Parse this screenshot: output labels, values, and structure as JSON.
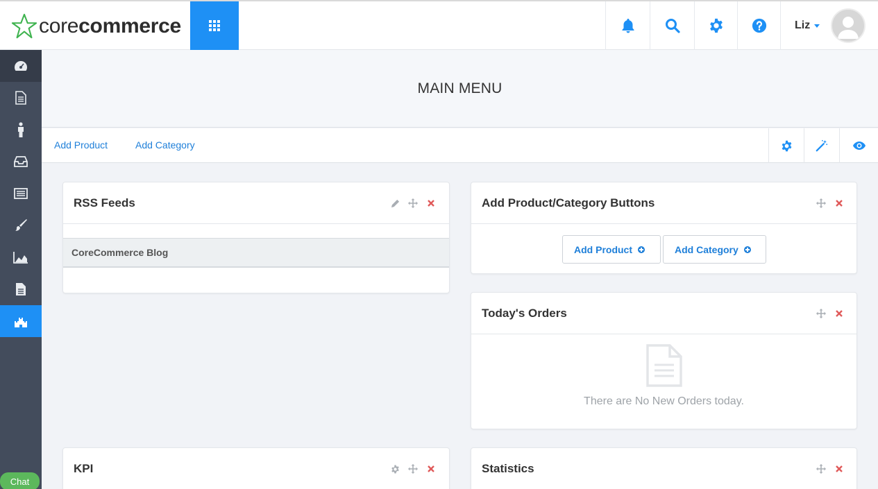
{
  "brand": {
    "name_part1": "core",
    "name_part2": "commerce"
  },
  "topbar": {
    "icons": [
      "grid-icon",
      "bell-icon",
      "search-icon",
      "gear-icon",
      "help-icon"
    ],
    "user_name": "Liz",
    "accent_color": "#1e90f5"
  },
  "sidebar": {
    "items": [
      {
        "name": "dashboard-icon",
        "active": false
      },
      {
        "name": "pages-icon",
        "active": false
      },
      {
        "name": "customers-icon",
        "active": false
      },
      {
        "name": "orders-icon",
        "active": false
      },
      {
        "name": "catalog-icon",
        "active": false
      },
      {
        "name": "design-icon",
        "active": false
      },
      {
        "name": "reports-icon",
        "active": false
      },
      {
        "name": "content-icon",
        "active": false
      },
      {
        "name": "castle-icon",
        "active": true
      }
    ],
    "chat_label": "Chat"
  },
  "header": {
    "title": "MAIN MENU"
  },
  "toolbar": {
    "add_product_label": "Add Product",
    "add_category_label": "Add Category",
    "icons": [
      "gear-icon",
      "magic-wand-icon",
      "eye-icon"
    ]
  },
  "panels": {
    "rss": {
      "title": "RSS Feeds",
      "feed_name": "CoreCommerce Blog"
    },
    "buttons": {
      "title": "Add Product/Category Buttons",
      "add_product_label": "Add Product",
      "add_category_label": "Add Category"
    },
    "orders": {
      "title": "Today's Orders",
      "empty_message": "There are No New Orders today."
    },
    "kpi": {
      "title": "KPI"
    },
    "statistics": {
      "title": "Statistics"
    }
  }
}
